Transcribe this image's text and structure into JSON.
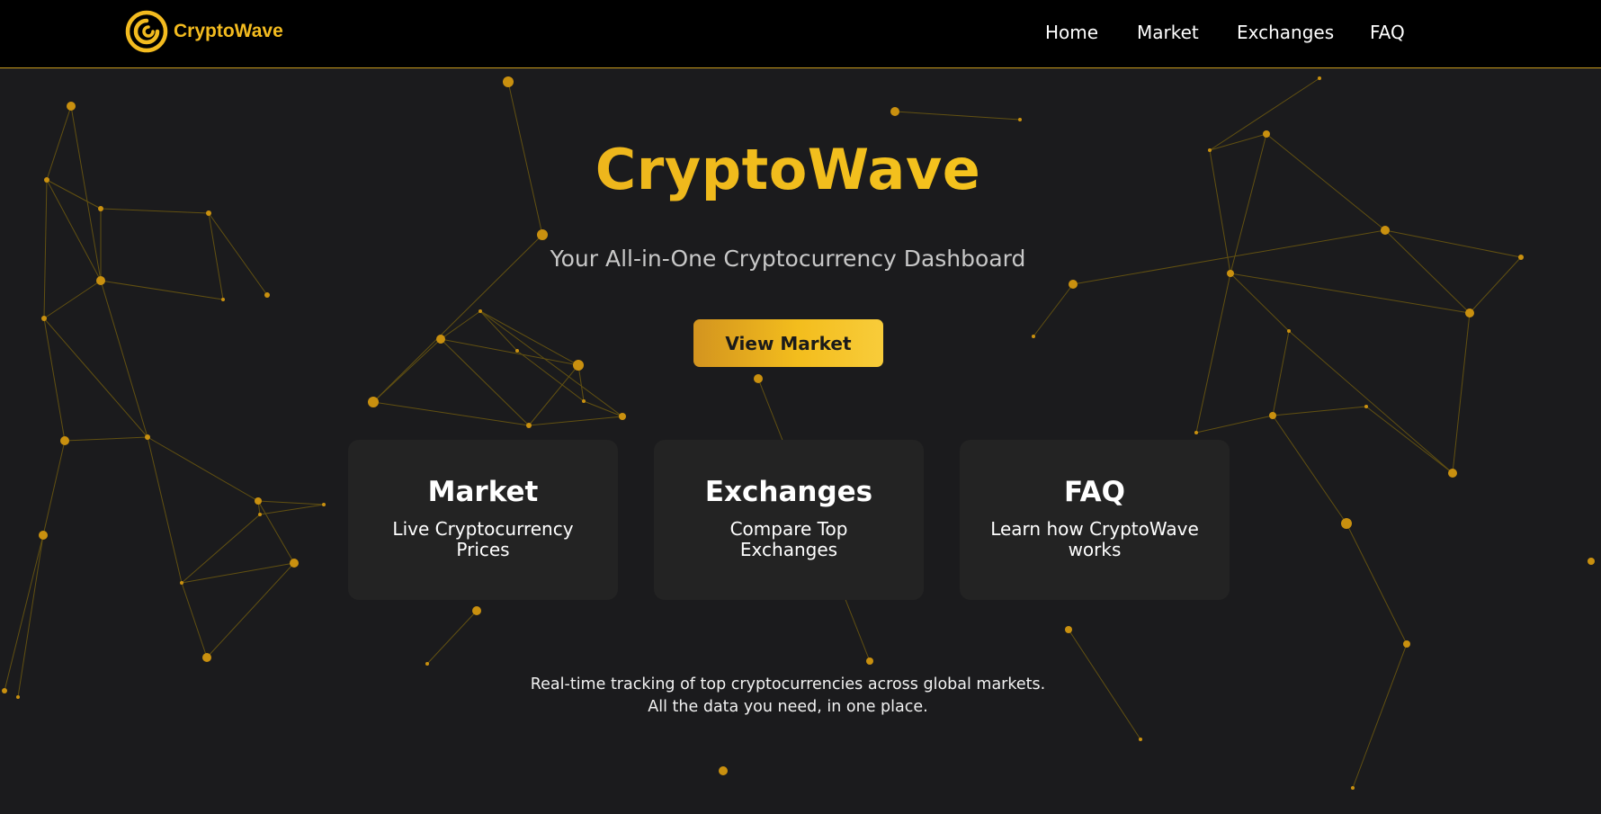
{
  "brand": {
    "name": "CryptoWave",
    "accent_color": "#f3bb1f",
    "logo_icon": "wave-coin-icon"
  },
  "nav": {
    "items": [
      {
        "label": "Home"
      },
      {
        "label": "Market"
      },
      {
        "label": "Exchanges"
      },
      {
        "label": "FAQ"
      }
    ]
  },
  "hero": {
    "title": "CryptoWave",
    "subtitle": "Your All-in-One Cryptocurrency Dashboard",
    "cta_label": "View Market"
  },
  "cards": [
    {
      "title": "Market",
      "description": "Live Cryptocurrency Prices"
    },
    {
      "title": "Exchanges",
      "description": "Compare Top Exchanges"
    },
    {
      "title": "FAQ",
      "description": "Learn how CryptoWave works"
    }
  ],
  "tagline": {
    "line1": "Real-time tracking of top cryptocurrencies across global markets.",
    "line2": "All the data you need, in one place."
  },
  "colors": {
    "background": "#1b1b1d",
    "header": "#000000",
    "card": "#232323",
    "network_node": "#c9900f"
  }
}
